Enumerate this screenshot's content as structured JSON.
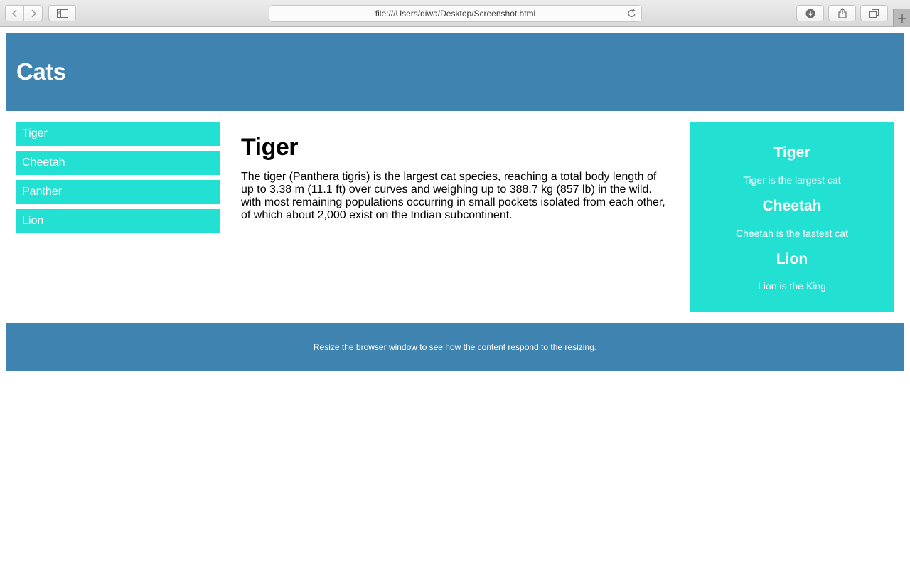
{
  "browser": {
    "address": "file:///Users/diwa/Desktop/Screenshot.html",
    "icons": [
      "back-icon",
      "forward-icon",
      "sidebar-icon",
      "reload-icon",
      "download-icon",
      "share-icon",
      "tabs-icon",
      "new-tab-icon"
    ]
  },
  "header": {
    "title": "Cats"
  },
  "menu": {
    "items": [
      {
        "label": "Tiger"
      },
      {
        "label": "Cheetah"
      },
      {
        "label": "Panther"
      },
      {
        "label": "Lion"
      }
    ]
  },
  "main": {
    "title": "Tiger",
    "body": "The tiger (Panthera tigris) is the largest cat species, reaching a total body length of up to 3.38 m (11.1 ft) over curves and weighing up to 388.7 kg (857 lb) in the wild. with most remaining populations occurring in small pockets isolated from each other, of which about 2,000 exist on the Indian subcontinent."
  },
  "aside": {
    "entries": [
      {
        "title": "Tiger",
        "text": "Tiger is the largest cat"
      },
      {
        "title": "Cheetah",
        "text": "Cheetah is the fastest cat"
      },
      {
        "title": "Lion",
        "text": "Lion is the King"
      }
    ]
  },
  "footer": {
    "text": "Resize the browser window to see how the content respond to the resizing."
  },
  "colors": {
    "header": "#3f83b1",
    "accent": "#22e0d2"
  }
}
